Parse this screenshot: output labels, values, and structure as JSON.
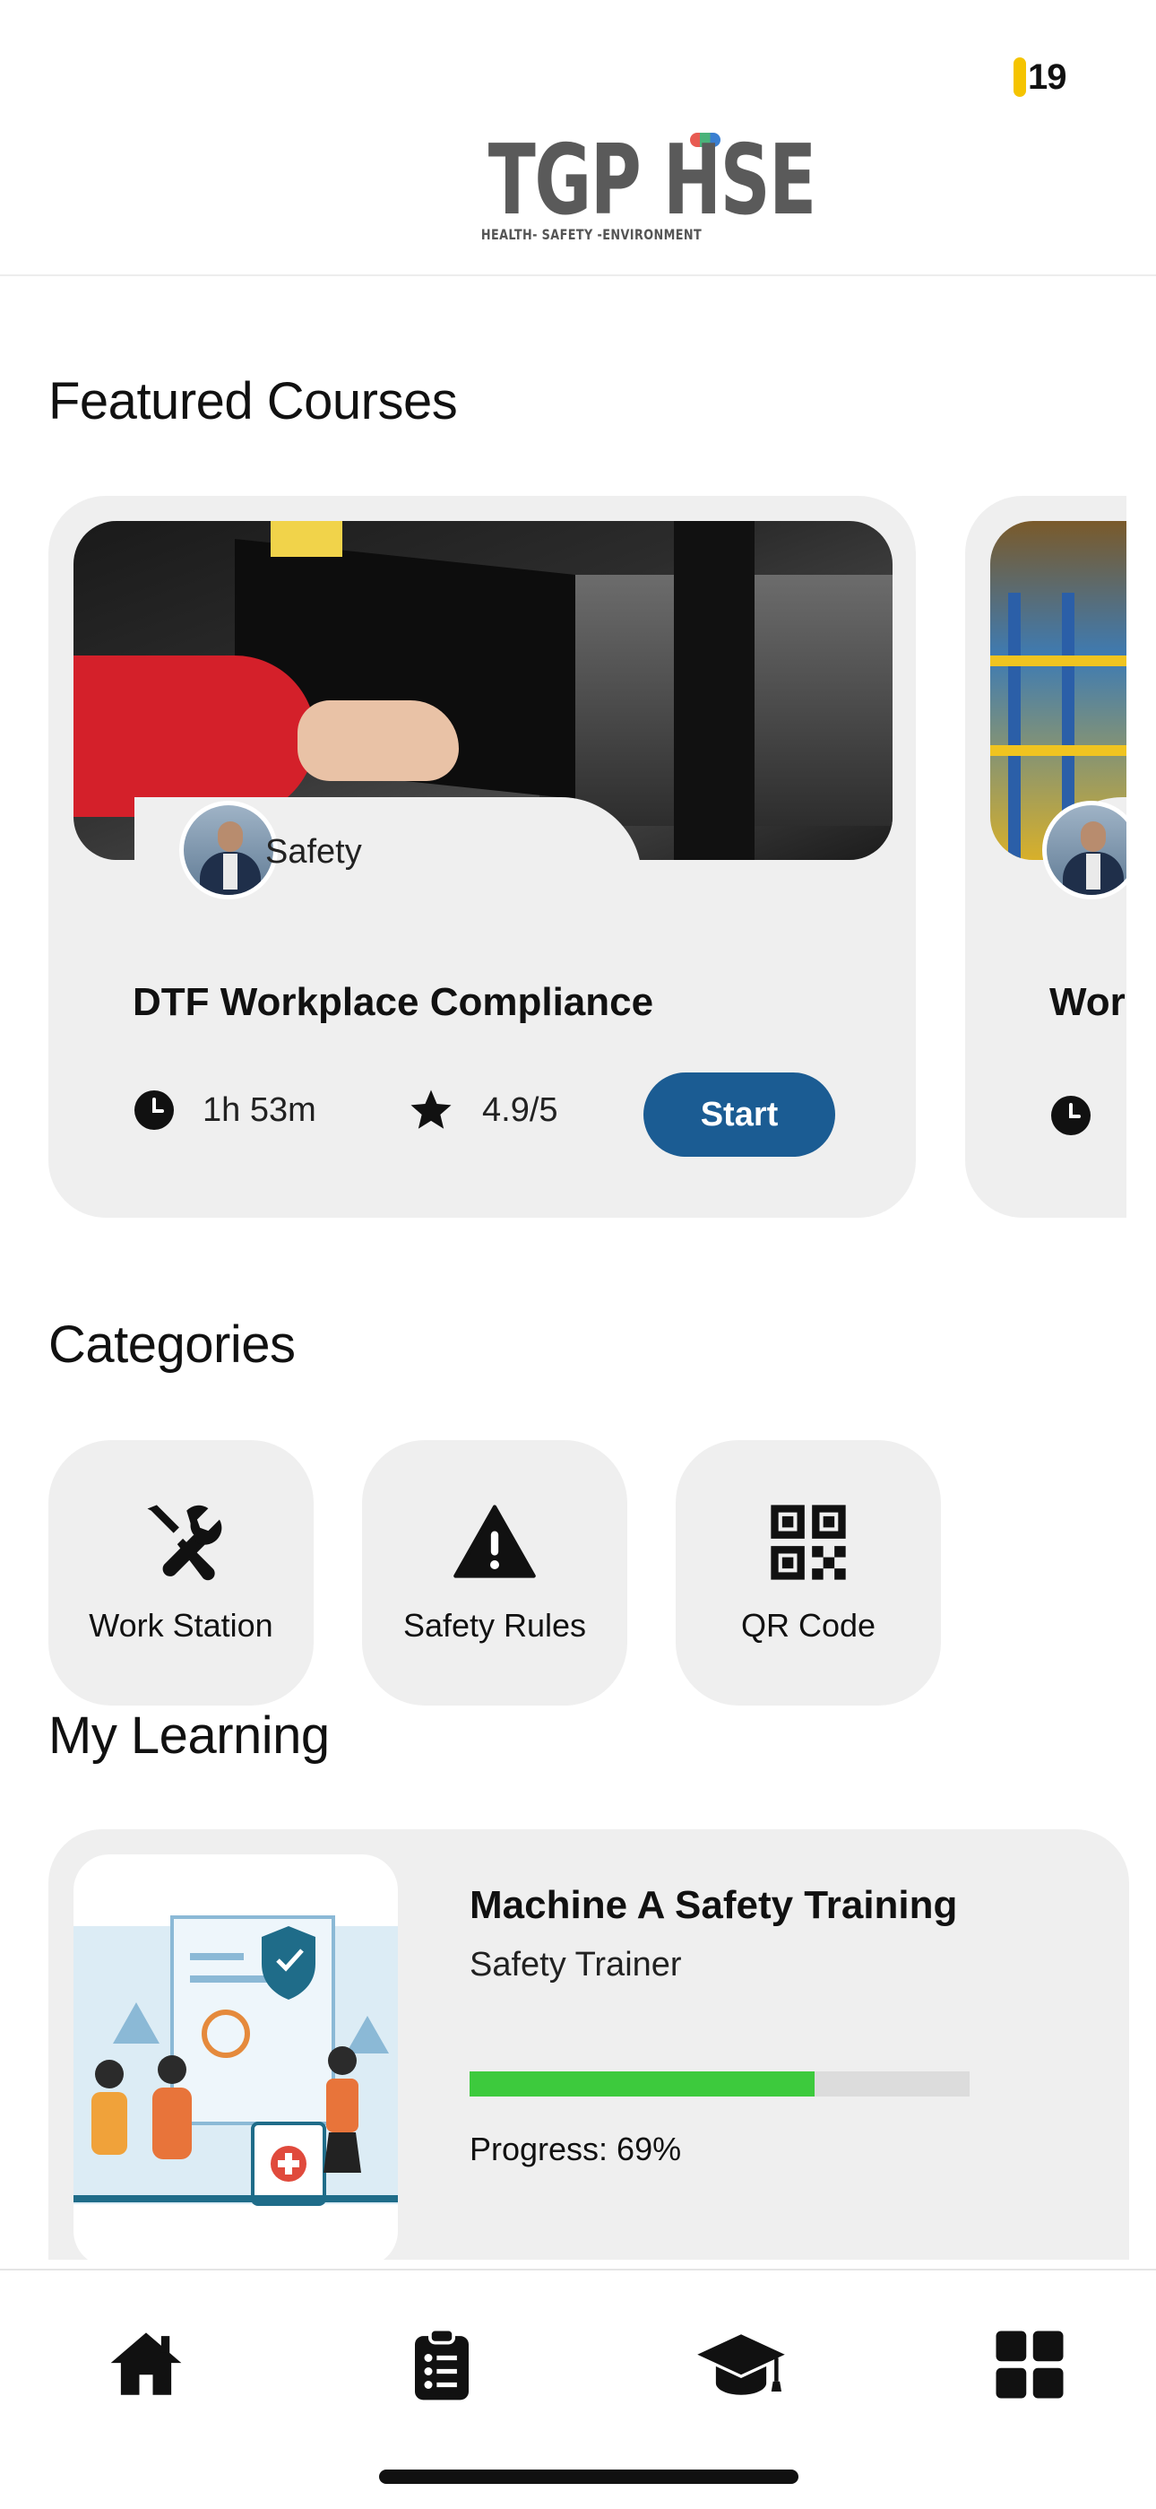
{
  "status_bar": {
    "battery": "19"
  },
  "header": {
    "logo_text": "TGP HSE",
    "logo_tagline": "HEALTH- SAFETY -ENVIRONMENT"
  },
  "featured": {
    "heading": "Featured Courses",
    "courses": [
      {
        "category": "Safety",
        "title": "DTF Workplace Compliance",
        "duration": "1h 53m",
        "rating": "4.9/5",
        "action": "Start"
      },
      {
        "title": "Worl"
      }
    ]
  },
  "categories": {
    "heading": "Categories",
    "items": [
      {
        "label": "Work Station",
        "icon": "tools-icon"
      },
      {
        "label": "Safety Rules",
        "icon": "warning-icon"
      },
      {
        "label": "QR Code",
        "icon": "qr-code-icon"
      }
    ]
  },
  "my_learning": {
    "heading": "My Learning",
    "course": {
      "title": "Machine A Safety Training",
      "subtitle": "Safety Trainer",
      "progress": 0.69,
      "progress_text": "Progress: 69%"
    }
  },
  "nav": {
    "items": [
      "home-icon",
      "clipboard-list-icon",
      "graduation-cap-icon",
      "grid-icon"
    ]
  },
  "colors": {
    "accent": "#1b5c93",
    "progress": "#3dca3d",
    "card_bg": "#efefef"
  }
}
